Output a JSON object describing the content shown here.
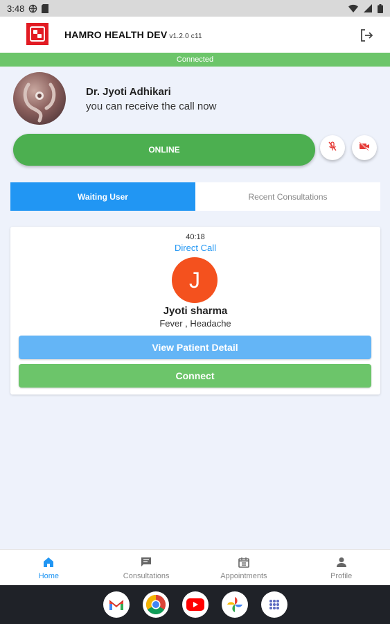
{
  "statusbar": {
    "time": "3:48"
  },
  "appbar": {
    "title": "HAMRO HEALTH DEV",
    "version": "v1.2.0 c11"
  },
  "connection": {
    "status": "Connected"
  },
  "doctor": {
    "name": "Dr. Jyoti Adhikari",
    "subtitle": "you can receive the call now"
  },
  "status_button": {
    "label": "ONLINE"
  },
  "tabs": [
    {
      "label": "Waiting User",
      "active": true
    },
    {
      "label": "Recent Consultations",
      "active": false
    }
  ],
  "waiting_card": {
    "time": "40:18",
    "call_type": "Direct Call",
    "initial": "J",
    "patient_name": "Jyoti sharma",
    "symptoms": "Fever , Headache",
    "view_label": "View Patient Detail",
    "connect_label": "Connect"
  },
  "bottom_nav": [
    {
      "label": "Home",
      "icon": "home-icon",
      "active": true
    },
    {
      "label": "Consultations",
      "icon": "chat-icon",
      "active": false
    },
    {
      "label": "Appointments",
      "icon": "calendar-icon",
      "active": false
    },
    {
      "label": "Profile",
      "icon": "person-icon",
      "active": false
    }
  ],
  "dock": [
    "gmail-icon",
    "chrome-icon",
    "youtube-icon",
    "photos-icon",
    "apps-icon"
  ],
  "colors": {
    "online": "#4caf50",
    "active_tab": "#2196f3",
    "connected_bar": "#6cc56a",
    "avatar_initial": "#f4511e",
    "logo": "#e21b23"
  }
}
